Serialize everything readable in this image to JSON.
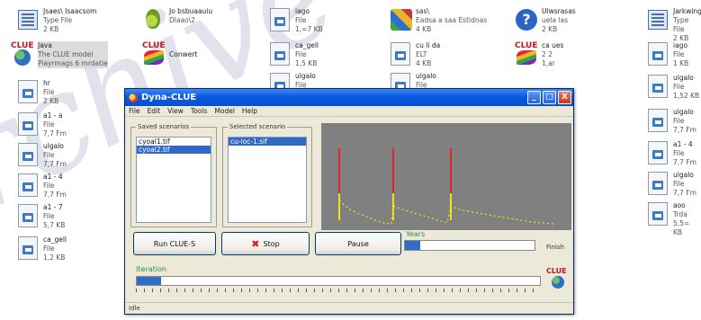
{
  "desktop": {
    "icons": [
      {
        "name": "Jsaes\\ Isaacsom",
        "line2": "Type File",
        "line3": "2 KB"
      },
      {
        "name": "Jo bsbuaauiu",
        "line2": "Dlaao\\2",
        "line3": ""
      },
      {
        "name": "iago",
        "line2": "File",
        "line3": "1,=7 KB"
      },
      {
        "name": "sas\\",
        "line2": "Eadsa a saa Estidnas",
        "line3": "4 KB"
      },
      {
        "name": "Ulwsrasas",
        "line2": "uela las",
        "line3": "2 KB"
      },
      {
        "name": "Jarkwing",
        "line2": "Type File",
        "line3": "2 KB"
      },
      {
        "name": "Java",
        "line2": "The CLUE model",
        "line3": "Piayrmags 6 mrdatie"
      },
      {
        "name": "Conwert",
        "line2": "",
        "line3": ""
      },
      {
        "name": "ca_gell",
        "line2": "File",
        "line3": "1,5 KB"
      },
      {
        "name": "cu li da",
        "line2": "ELT",
        "line3": "4 KB"
      },
      {
        "name": "ca ues",
        "line2": "2 2",
        "line3": "1,ar"
      },
      {
        "name": "iago",
        "line2": "File",
        "line3": "1 KB"
      },
      {
        "name": "hr",
        "line2": "File",
        "line3": "2 KB"
      },
      {
        "name": "ulgalo",
        "line2": "File",
        "line3": "KB"
      },
      {
        "name": "ulgalo",
        "line2": "File",
        "line3": "1,5 KB"
      },
      {
        "name": "ulgalo",
        "line2": "File",
        "line3": "1,52 KB"
      },
      {
        "name": "a1 - a",
        "line2": "File",
        "line3": "7,7 Fm"
      },
      {
        "name": "ulgalo",
        "line2": "File",
        "line3": "7,7 Fm"
      },
      {
        "name": "a1 - 4",
        "line2": "File",
        "line3": "7,7 Fm"
      },
      {
        "name": "ulgalo",
        "line2": "File",
        "line3": "7,7 Fm"
      },
      {
        "name": "a1 - 4",
        "line2": "File",
        "line3": "7,7 Fm"
      },
      {
        "name": "ulgalo",
        "line2": "File",
        "line3": "7,7 Fm"
      },
      {
        "name": "a1 - 7",
        "line2": "File",
        "line3": "5,7 KB"
      },
      {
        "name": "aoo",
        "line2": "Trda",
        "line3": "5,5= KB"
      },
      {
        "name": "ca_gell",
        "line2": "File",
        "line3": "1,2 KB"
      }
    ]
  },
  "watermark": "rchive",
  "window": {
    "title": "Dyna-CLUE",
    "buttons": {
      "minimize": "_",
      "maximize": "□",
      "close": "X"
    },
    "menu": [
      "File",
      "Edit",
      "View",
      "Tools",
      "Model",
      "Help"
    ],
    "left_group_title": "Saved scenarios",
    "left_items": [
      "cyoal1.tif",
      "cyoal2.tif"
    ],
    "right_group_title": "Selected scenario",
    "right_items": [
      "cu-loc-1.sif"
    ],
    "run_label": "Run CLUE-S",
    "stop_label": "Stop",
    "pause_label": "Pause",
    "years_label": "Years",
    "years_progress": 0.12,
    "finish_label": "Finish",
    "iteration_label": "Iteration",
    "iteration_progress": 0.06,
    "status": "Idle",
    "logo_text": "CLUE"
  },
  "colors": {
    "accent_blue": "#316ac5",
    "chart_bg": "#808080",
    "spike_red": "#e8202a",
    "spike_yellow": "#f0e21a"
  }
}
